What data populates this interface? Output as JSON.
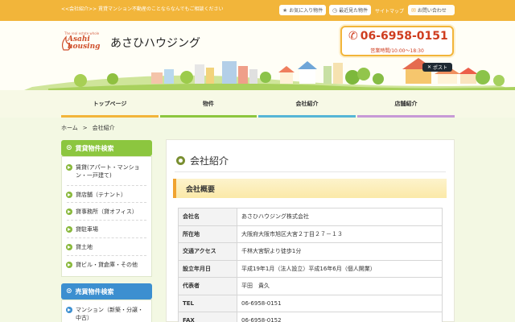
{
  "topbar": {
    "tagline": "<<会社紹介>> 賃貸マンション不動産のことならなんでもご相談ください",
    "favorites": "お気に入り物件",
    "recent": "最近見た物件",
    "sitemap": "サイトマップ",
    "contact": "お問い合わせ"
  },
  "header": {
    "logo_tagline": "The real estate whole",
    "logo_line1": "Asahi",
    "logo_line2": "housing",
    "site_name": "あさひハウジング",
    "phone": "06-6958-0151",
    "hours": "営業時間/10:00～18:30",
    "post": "ポスト"
  },
  "nav": [
    {
      "label": "トップページ",
      "color": "#f2b53a"
    },
    {
      "label": "物件",
      "color": "#8cc63f"
    },
    {
      "label": "会社紹介",
      "color": "#56b6d6"
    },
    {
      "label": "店舗紹介",
      "color": "#c79ad6"
    }
  ],
  "breadcrumb": {
    "home": "ホーム",
    "sep": ">",
    "current": "会社紹介"
  },
  "sidebar": {
    "rent_title": "賃貸物件検索",
    "rent_items": [
      "賃貸(アパート・マンション・一戸建て)",
      "貸店舗（テナント）",
      "貸事務所（貸オフィス）",
      "貸駐車場",
      "貸土地",
      "貸ビル・貸倉庫・その他"
    ],
    "sale_title": "売買物件検索",
    "sale_items": [
      "マンション（新築・分譲・中古）"
    ]
  },
  "content": {
    "title": "会社紹介",
    "section": "会社概要",
    "rows": [
      {
        "k": "会社名",
        "v": "あさひハウジング株式会社"
      },
      {
        "k": "所在地",
        "v": "大阪府大阪市旭区大宮２丁目２７－１３"
      },
      {
        "k": "交通アクセス",
        "v": "千林大宮駅より徒歩1分"
      },
      {
        "k": "設立年月日",
        "v": "平成19年1月（法人設立）平成16年6月（個人開業）"
      },
      {
        "k": "代表者",
        "v": "平田　貴久"
      },
      {
        "k": "TEL",
        "v": "06-6958-0151"
      },
      {
        "k": "FAX",
        "v": "06-6958-0152"
      }
    ]
  },
  "colors": {
    "accent": "#f2b53a",
    "green": "#8cc63f",
    "blue": "#3c8fd0",
    "phone_red": "#cf3d1f"
  }
}
